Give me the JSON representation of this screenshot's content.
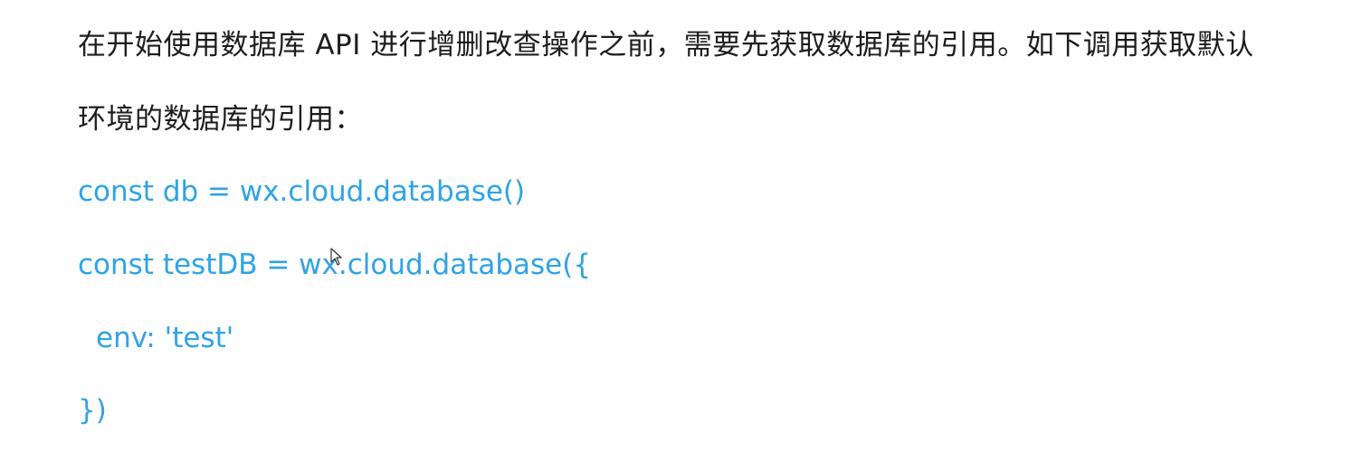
{
  "intro": {
    "line1": "在开始使用数据库 API 进行增删改查操作之前，需要先获取数据库的引用。如下调用获取默认",
    "line2": "环境的数据库的引用："
  },
  "code": {
    "line1": "const db = wx.cloud.database()",
    "line2": "const testDB = wx.cloud.database({",
    "line3": "env: 'test'",
    "line4": "})"
  },
  "colors": {
    "prose": "#1d1d1d",
    "code": "#2fa3e6",
    "background": "#fefefe"
  },
  "icons": {
    "cursor": "mouse-pointer-icon"
  }
}
